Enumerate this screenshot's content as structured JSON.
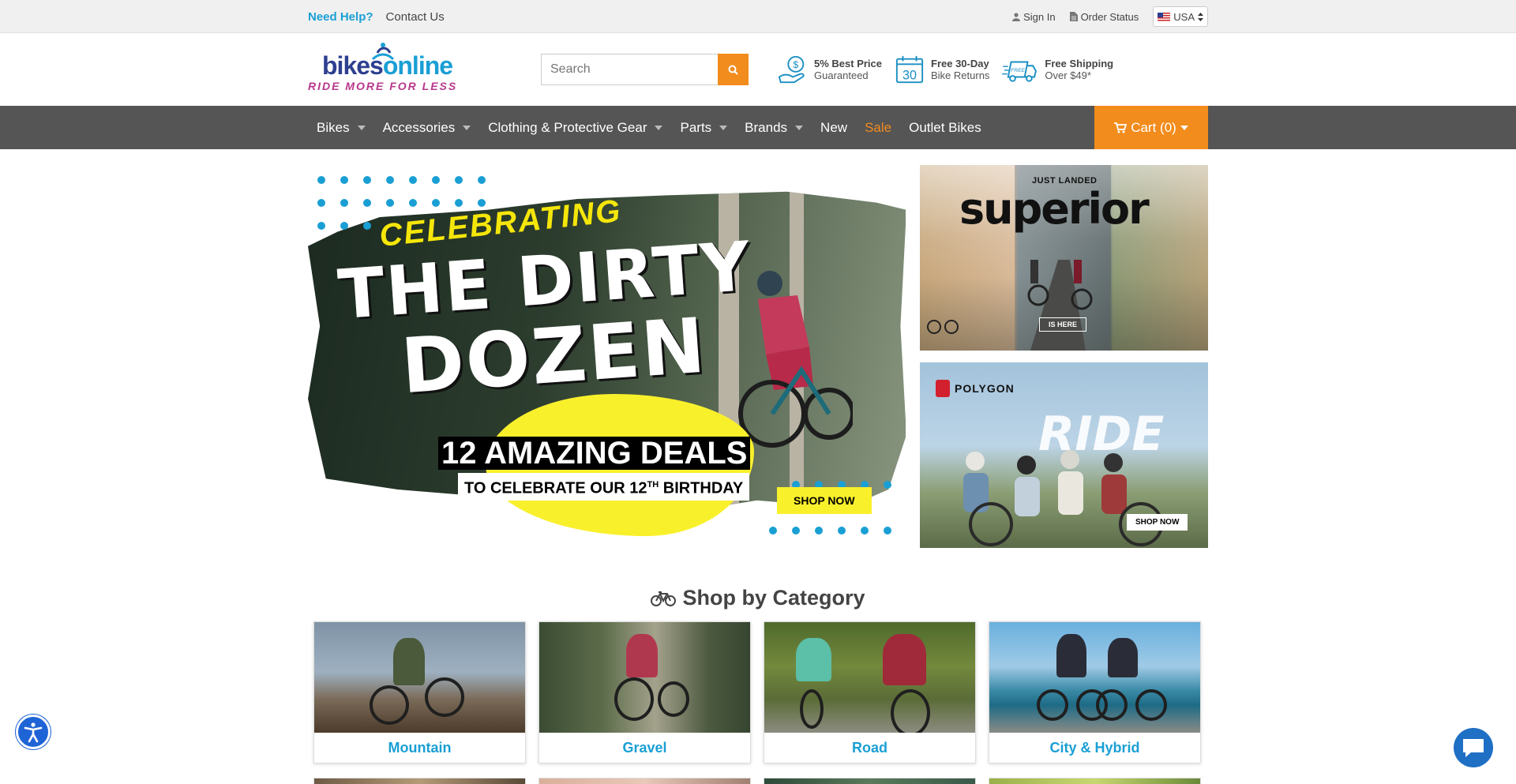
{
  "topbar": {
    "help": "Need Help?",
    "contact": "Contact Us",
    "sign_in": "Sign In",
    "order_status": "Order Status",
    "country": "USA"
  },
  "header": {
    "logo_text_1": "bikes",
    "logo_text_2": "online",
    "logo_tagline": "RIDE MORE FOR LESS",
    "search_placeholder": "Search",
    "perks": [
      {
        "title": "5% Best Price",
        "sub": "Guaranteed",
        "icon": "price-guarantee-icon"
      },
      {
        "title": "Free 30-Day",
        "sub": "Bike Returns",
        "icon": "calendar-30-icon",
        "badge": "30"
      },
      {
        "title": "Free Shipping",
        "sub": "Over $49*",
        "icon": "free-shipping-truck-icon",
        "badge": "FREE"
      }
    ]
  },
  "nav": {
    "items": [
      {
        "label": "Bikes",
        "dropdown": true
      },
      {
        "label": "Accessories",
        "dropdown": true
      },
      {
        "label": "Clothing & Protective Gear",
        "dropdown": true
      },
      {
        "label": "Parts",
        "dropdown": true
      },
      {
        "label": "Brands",
        "dropdown": true
      },
      {
        "label": "New",
        "dropdown": false
      },
      {
        "label": "Sale",
        "dropdown": false
      },
      {
        "label": "Outlet Bikes",
        "dropdown": false
      }
    ],
    "cart": "Cart (0)"
  },
  "hero": {
    "celebrating": "CELEBRATING",
    "line1": "THE DIRTY",
    "line2": "DOZEN",
    "deals": "12 AMAZING DEALS",
    "birthday_pre": "TO CELEBRATE OUR 12",
    "birthday_sup": "TH",
    "birthday_post": " BIRTHDAY",
    "cta": "SHOP NOW"
  },
  "promos": {
    "superior": {
      "kicker": "JUST LANDED",
      "brand": "superior",
      "cta": "IS HERE"
    },
    "polygon": {
      "brand": "POLYGON",
      "headline": "RIDE",
      "cta": "SHOP NOW"
    }
  },
  "categories": {
    "title": "Shop by Category",
    "items": [
      "Mountain",
      "Gravel",
      "Road",
      "City & Hybrid"
    ]
  },
  "colors": {
    "accent_orange": "#f28c1c",
    "link_blue": "#1a9fd4",
    "nav_gray": "#555555"
  }
}
